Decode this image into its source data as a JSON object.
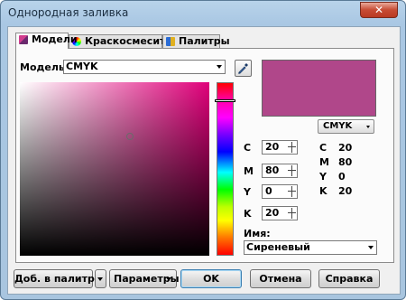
{
  "window": {
    "title": "Однородная заливка",
    "close_glyph": "✕"
  },
  "tabs": [
    {
      "label": "Модели",
      "icon": "models-icon",
      "active": true
    },
    {
      "label": "Краскосмесители",
      "icon": "color-wheel-icon",
      "active": false
    },
    {
      "label": "Палитры",
      "icon": "palette-icon",
      "active": false
    }
  ],
  "model": {
    "label": "Модель:",
    "selected": "CMYK"
  },
  "color": {
    "hex": "#b0478a",
    "cmyk": {
      "c": 20,
      "m": 80,
      "y": 0,
      "k": 20
    }
  },
  "channels": [
    {
      "label": "C",
      "value": "20"
    },
    {
      "label": "M",
      "value": "80"
    },
    {
      "label": "Y",
      "value": "0"
    },
    {
      "label": "K",
      "value": "20"
    }
  ],
  "readout": {
    "model": "CMYK",
    "rows": [
      {
        "label": "C",
        "value": "20"
      },
      {
        "label": "M",
        "value": "80"
      },
      {
        "label": "Y",
        "value": "0"
      },
      {
        "label": "K",
        "value": "20"
      }
    ]
  },
  "name": {
    "label": "Имя:",
    "value": "Сиреневый"
  },
  "buttons": {
    "add_to_palette": "Доб. в палитру",
    "parameters": "Параметры",
    "ok": "OK",
    "cancel": "Отмена",
    "help": "Справка"
  }
}
